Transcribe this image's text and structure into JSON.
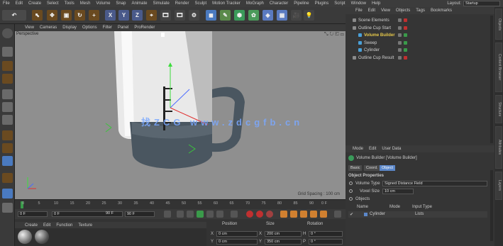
{
  "menubar": {
    "items": [
      "File",
      "Edit",
      "Create",
      "Select",
      "Tools",
      "Mesh",
      "Volume",
      "Snap",
      "Animate",
      "Simulate",
      "Render",
      "Sculpt",
      "Motion Tracker",
      "MoGraph",
      "Character",
      "Pipeline",
      "Plugins",
      "Script",
      "Window",
      "Help"
    ],
    "layout_label": "Layout:",
    "layout_value": "Startup"
  },
  "toolbar": {
    "x_axis": "X",
    "y_axis": "Y",
    "z_axis": "Z"
  },
  "viewport": {
    "menu": [
      "View",
      "Cameras",
      "Display",
      "Options",
      "Filter",
      "Panel",
      "ProRender"
    ],
    "label": "Perspective",
    "grid_spacing": "Grid Spacing : 100 cm",
    "watermark": "找ZCG www.zdcgfb.cn"
  },
  "timeline": {
    "ticks": [
      "0",
      "5",
      "10",
      "15",
      "20",
      "25",
      "30",
      "35",
      "40",
      "45",
      "50",
      "55",
      "60",
      "65",
      "70",
      "75",
      "80",
      "85",
      "90"
    ],
    "end_label": "0 F"
  },
  "transport": {
    "current_frame": "0 F",
    "min_frame": "0 F",
    "max_frame": "90 F",
    "end_frame": "90 F"
  },
  "materials": {
    "menu": [
      "Create",
      "Edit",
      "Function",
      "Texture"
    ]
  },
  "coordinates": {
    "headers": [
      "Position",
      "Size",
      "Rotation"
    ],
    "rows": [
      {
        "axis": "X",
        "pos": "0 cm",
        "size": "200 cm",
        "rot_axis": "H",
        "rot": "0 °"
      },
      {
        "axis": "Y",
        "pos": "0 cm",
        "size": "350 cm",
        "rot_axis": "P",
        "rot": "0 °"
      }
    ]
  },
  "object_manager": {
    "menu": [
      "File",
      "Edit",
      "View",
      "Objects",
      "Tags",
      "Bookmarks"
    ],
    "objects": [
      {
        "name": "Scene Elements",
        "indent": 0,
        "color": "#cfcfcf",
        "selected": false
      },
      {
        "name": "Outline Cup Start",
        "indent": 0,
        "color": "#cfcfcf",
        "selected": false
      },
      {
        "name": "Volume Builder",
        "indent": 1,
        "color": "#e6c84a",
        "selected": true
      },
      {
        "name": "Sweep",
        "indent": 1,
        "color": "#cfcfcf",
        "selected": false
      },
      {
        "name": "Cylinder",
        "indent": 1,
        "color": "#cfcfcf",
        "selected": false
      },
      {
        "name": "Outline Cup Result",
        "indent": 0,
        "color": "#cfcfcf",
        "selected": false
      }
    ]
  },
  "attributes": {
    "menu": [
      "Mode",
      "Edit",
      "User Data"
    ],
    "object_title": "Volume Builder [Volume Builder]",
    "tabs": [
      "Basic",
      "Coord.",
      "Object"
    ],
    "active_tab": "Object",
    "section": "Object Properties",
    "volume_type_label": "Volume Type",
    "volume_type_value": "Signed Distance Field",
    "voxel_size_label": "Voxel Size",
    "voxel_size_value": "10 cm",
    "objects_label": "Objects",
    "table_headers": [
      "Name",
      "Mode",
      "Input Type"
    ],
    "table_row": {
      "name": "Cylinder",
      "input_type": "Lists"
    }
  },
  "right_tabs": [
    "Objects",
    "Content Browser",
    "Structure",
    "Attributes",
    "Layers"
  ],
  "colors": {
    "accent": "#5b87c9",
    "selected_text": "#e6c84a",
    "viewport_bg": "#8f8f8f"
  }
}
